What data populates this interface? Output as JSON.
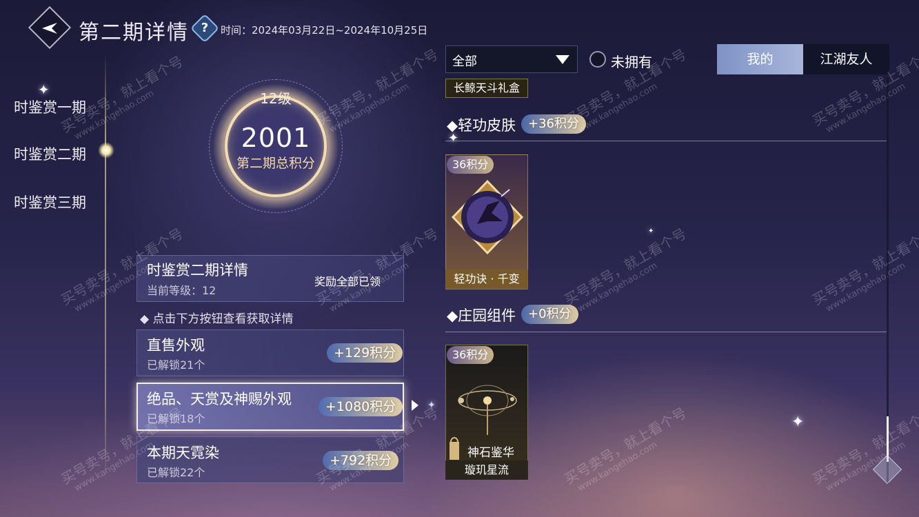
{
  "header": {
    "back_icon": "back-arrow-icon",
    "title": "第二期详情",
    "help_glyph": "?",
    "time_text": "时间：2024年03月22日~2024年10月25日"
  },
  "nav": {
    "items": [
      {
        "label": "时鉴赏一期",
        "active": false
      },
      {
        "label": "时鉴赏二期",
        "active": true
      },
      {
        "label": "时鉴赏三期",
        "active": false
      }
    ]
  },
  "ring": {
    "level": "12级",
    "score": "2001",
    "score_label": "第二期总积分"
  },
  "detail": {
    "title": "时鉴赏二期详情",
    "level_text": "当前等级：12",
    "reward_text": "奖励全部已领"
  },
  "hint": "◆ 点击下方按钮查看获取详情",
  "categories": [
    {
      "title": "直售外观",
      "sub": "已解锁21个",
      "points": "+129积分",
      "selected": false
    },
    {
      "title": "绝品、天赏及神赐外观",
      "sub": "已解锁18个",
      "points": "+1080积分",
      "selected": true
    },
    {
      "title": "本期天霓染",
      "sub": "已解锁22个",
      "points": "+792积分",
      "selected": false
    }
  ],
  "filters": {
    "dropdown_value": "全部",
    "radio_label": "未拥有",
    "tab_mine": "我的",
    "tab_friends": "江湖友人",
    "gift_tag": "长鲸天斗礼盒"
  },
  "sections": [
    {
      "title": "◆轻功皮肤",
      "points": "+36积分",
      "cards": [
        {
          "badge": "36积分",
          "name": "轻功诀 · 千变"
        }
      ]
    },
    {
      "title": "◆庄园组件",
      "points": "+0积分",
      "cards": [
        {
          "badge": "36积分",
          "overlay": "神石鉴华",
          "name": "璇玑星流"
        }
      ]
    }
  ],
  "watermark": {
    "line1": "买号卖号，就上看个号",
    "line2": "www.kangehao.com",
    "line3": "看个号"
  },
  "colors": {
    "accent_gold": "#f2d9a5",
    "tab_active": "#8fa2cf",
    "points_pill_start": "#506eb4",
    "points_pill_end": "#f0dcaa"
  }
}
